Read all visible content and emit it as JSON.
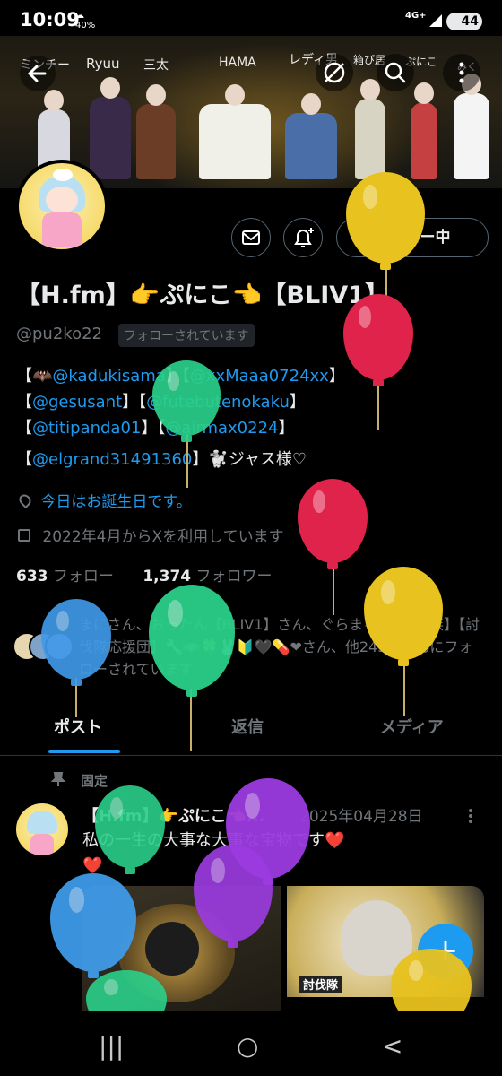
{
  "status_bar": {
    "time": "10:09",
    "weather": "40%",
    "network": "4G+",
    "battery": "44"
  },
  "banner": {
    "names": [
      "ミンチー",
      "Ryuu",
      "三太",
      "HAMA",
      "レディ男",
      "箱ぴ居",
      "ぷにこ",
      "みく"
    ]
  },
  "profile": {
    "display_name": "【H.fm】👉ぷにこ👈【BLIV1】",
    "handle": "@pu2ko22",
    "follows_you": "フォローされています",
    "follow_button": "フォロー中"
  },
  "bio": {
    "line1": [
      {
        "text": "【🦇"
      },
      {
        "text": "@kadukisama",
        "link": true
      },
      {
        "text": "】【"
      },
      {
        "text": "@xxMaaa0724xx",
        "link": true
      },
      {
        "text": "】"
      }
    ],
    "line2": [
      {
        "text": "【"
      },
      {
        "text": "@gesusant",
        "link": true
      },
      {
        "text": "】【"
      },
      {
        "text": "@futebutenokaku",
        "link": true
      },
      {
        "text": "】"
      }
    ],
    "line3": [
      {
        "text": "【"
      },
      {
        "text": "@titipanda01",
        "link": true
      },
      {
        "text": "】【"
      },
      {
        "text": "@airmax0224",
        "link": true
      },
      {
        "text": "】"
      }
    ],
    "line4": [
      {
        "text": "【"
      },
      {
        "text": "@elgrand31491360",
        "link": true
      },
      {
        "text": "】🐩ジャス様♡"
      }
    ]
  },
  "meta": {
    "birthday": "今日はお誕生日です。",
    "joined": "2022年4月からXを利用しています"
  },
  "stats": {
    "following_count": "633",
    "following_label": "フォロー",
    "followers_count": "1,374",
    "followers_label": "フォロワー"
  },
  "followed_by": "まにさん、おったん【BLIV1】さん、ぐらまる【lucky族】【討伐隊応援団】🔧🦇🍀🐰🔰🖤💊❤さん、他245人さんにフォローされています",
  "tabs": [
    {
      "label": "ポスト",
      "active": true
    },
    {
      "label": "返信",
      "active": false
    },
    {
      "label": "メディア",
      "active": false
    }
  ],
  "post": {
    "pinned_label": "固定",
    "author": "【H.fm】👉ぷにこ👈...",
    "date": "2025年04月28日",
    "text": "私の一生の大事な大事な宝物です❤️❤️",
    "media2_label": "討伐隊"
  },
  "fab_label": "+",
  "nav": {
    "recent": "|||",
    "home": "○",
    "back": "<"
  },
  "colors": {
    "accent": "#1d9bf0",
    "background": "#000000",
    "muted": "#71767b",
    "balloon_yellow": "#e8c21f",
    "balloon_red": "#e0234a",
    "balloon_green": "#2bd08a",
    "balloon_blue": "#3f9ae8",
    "balloon_purple": "#9b3be0"
  }
}
